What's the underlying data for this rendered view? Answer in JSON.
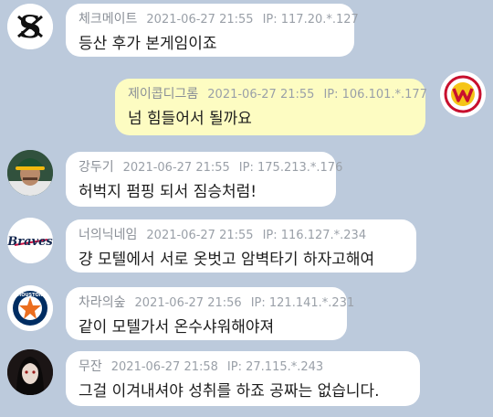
{
  "messages": [
    {
      "nick": "체크메이트",
      "date": "2021-06-27 21:55",
      "ip": "117.20.*.127",
      "text": "등산 후가 본게임이죠",
      "avatar": "white-sox-logo-icon"
    },
    {
      "nick": "제이콥디그롬",
      "date": "2021-06-27 21:55",
      "ip": "106.101.*.177",
      "text": "넘 힘들어서 될까요",
      "avatar": "wyverns-logo-icon"
    },
    {
      "nick": "강두기",
      "date": "2021-06-27 21:55",
      "ip": "175.213.*.176",
      "text": "허벅지 펌핑 되서 짐승처럼!",
      "avatar": "athletics-player-photo-icon"
    },
    {
      "nick": "너의닉네임",
      "date": "2021-06-27 21:55",
      "ip": "116.127.*.234",
      "text": "걍 모텔에서 서로 옷벗고 암벽타기 하자고해여",
      "avatar": "braves-logo-icon"
    },
    {
      "nick": "차라의숲",
      "date": "2021-06-27 21:56",
      "ip": "121.141.*.231",
      "text": "같이 모텔가서 온수샤워해야져",
      "avatar": "astros-logo-icon"
    },
    {
      "nick": "무잔",
      "date": "2021-06-27 21:58",
      "ip": "27.115.*.243",
      "text": "그걸 이겨내셔야 성취를 하죠 공짜는 없습니다.",
      "avatar": "muzan-portrait-icon"
    }
  ],
  "ip_label": "IP:",
  "logo_text": {
    "braves": "Braves",
    "astros": "HOUSTON"
  }
}
